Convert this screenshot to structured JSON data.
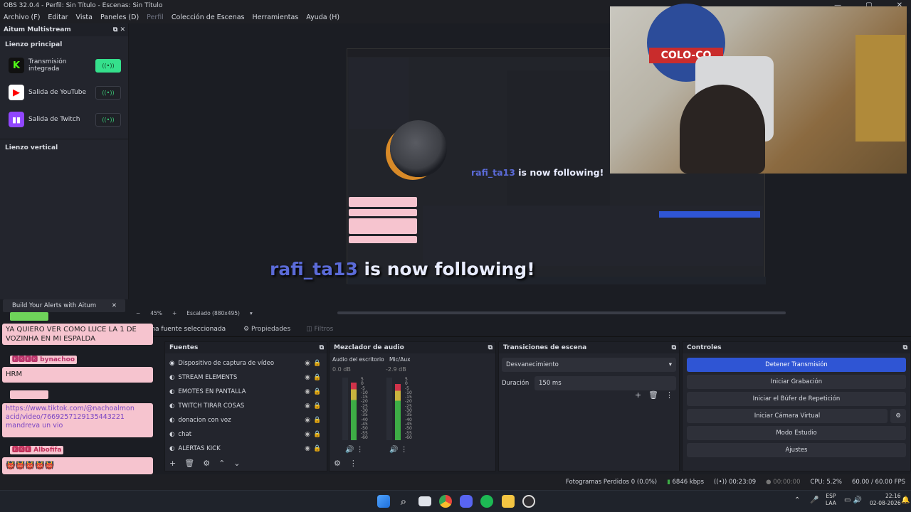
{
  "window": {
    "title": "OBS 32.0.4 - Perfil: Sin Título - Escenas: Sin Título"
  },
  "menu": [
    "Archivo (F)",
    "Editar",
    "Vista",
    "Paneles (D)",
    "Perfil",
    "Colección de Escenas",
    "Herramientas",
    "Ayuda (H)"
  ],
  "dock": {
    "title": "Aitum Multistream",
    "main_canvas": "Lienzo principal",
    "outputs": [
      {
        "label": "Transmisión integrada",
        "icon": "kick-icon",
        "active": true
      },
      {
        "label": "Salida de YouTube",
        "icon": "youtube-icon",
        "active": false
      },
      {
        "label": "Salida de Twitch",
        "icon": "twitch-icon",
        "active": false
      }
    ],
    "vertical_canvas": "Lienzo vertical",
    "alerts_banner": "Build Your Alerts with Aitum"
  },
  "overlay": {
    "follow_name": "rafi_ta13",
    "follow_text": " is now following!"
  },
  "zoom": {
    "level": "45%",
    "scaling": "Escalado (880x495)"
  },
  "source_bar": {
    "selected": "Ninguna fuente seleccionada",
    "properties": "Propiedades",
    "filters": "Filtros"
  },
  "sources": {
    "title": "Fuentes",
    "items": [
      "Dispositivo de captura de vídeo",
      "STREAM ELEMENTS",
      "EMOTES EN PANTALLA",
      "TWITCH TIRAR COSAS",
      "donacion con voz",
      "chat",
      "ALERTAS KICK"
    ]
  },
  "mixer": {
    "title": "Mezclador de audio",
    "channels": [
      {
        "name": "Audio del escritorio",
        "db": "0.0 dB",
        "level": 0.92
      },
      {
        "name": "Mic/Aux",
        "db": "-2.9 dB",
        "level": 0.9
      }
    ],
    "scale": [
      "5",
      "0",
      "-5",
      "-10",
      "-15",
      "-20",
      "-25",
      "-30",
      "-35",
      "-40",
      "-45",
      "-50",
      "-55",
      "-60"
    ]
  },
  "transitions": {
    "title": "Transiciones de escena",
    "selected": "Desvanecimiento",
    "duration_label": "Duración",
    "duration_value": "150 ms"
  },
  "controls": {
    "title": "Controles",
    "buttons": [
      "Detener Transmisión",
      "Iniciar Grabación",
      "Iniciar el Búfer de Repetición",
      "Iniciar Cámara Virtual",
      "Modo Estudio",
      "Ajustes"
    ]
  },
  "status": {
    "dropped": "Fotogramas Perdidos 0 (0.0%)",
    "bitrate": "6846 kbps",
    "stream_time": "00:23:09",
    "rec_time": "00:00:00",
    "cpu": "CPU: 5.2%",
    "fps": "60.00 / 60.00 FPS"
  },
  "chat": {
    "messages": [
      {
        "name": "",
        "text": "YA QUIERO VER COMO LUCE LA 1 DE VOZINHA EN MI ESPALDA"
      },
      {
        "name": "bynachoo",
        "text": "HRM"
      },
      {
        "name": "",
        "text": "https://www.tiktok.com/@nachoalmon acid/video/7669257129135443221 mandreva un vio"
      },
      {
        "name": "Albofifa",
        "text": "👹👹👹👹👹"
      }
    ]
  },
  "taskbar": {
    "lang": "ESP",
    "lang2": "LAA",
    "time": "22:16",
    "date": "02-08-2026"
  },
  "colors": {
    "accent": "#2f55d4",
    "kick": "#53fc18",
    "youtube": "#ff0000",
    "twitch": "#9146ff"
  }
}
